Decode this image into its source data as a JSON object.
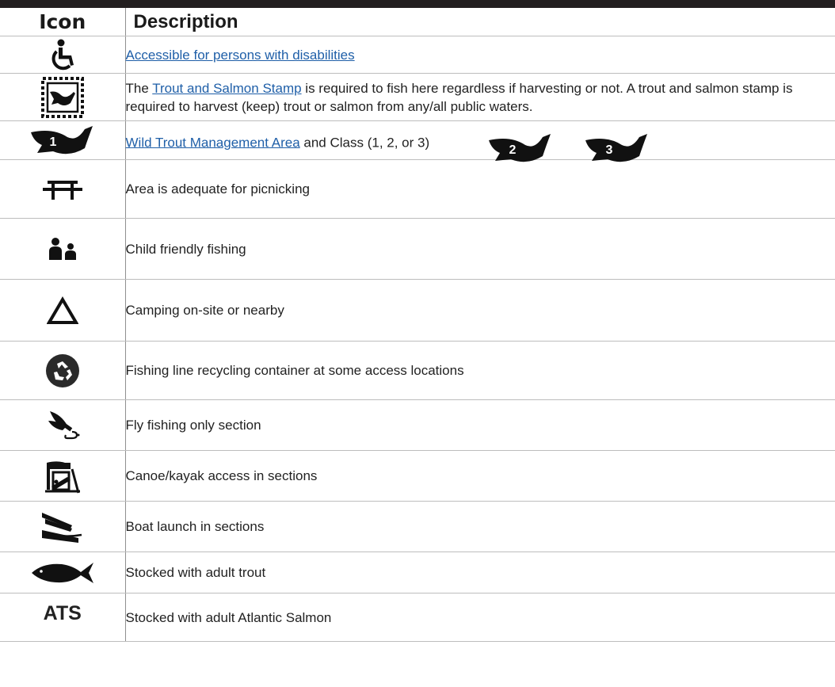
{
  "header": {
    "icon": "Icon",
    "description": "Description"
  },
  "rows": [
    {
      "icon": "wheelchair-icon",
      "link": "Accessible for persons with disabilities "
    },
    {
      "icon": "stamp-icon",
      "pre": "The ",
      "link": "Trout and Salmon Stamp",
      "post": " is required to fish here regardless if harvesting or not. A trout and salmon stamp is required to harvest (keep) trout or salmon from any/all public waters."
    },
    {
      "icon": "wild-trout-class-1-icon",
      "link": "Wild Trout Management Area",
      "post": " and Class (1, 2, or 3)",
      "badges": [
        "1",
        "2",
        "3"
      ]
    },
    {
      "icon": "picnic-table-icon",
      "text": "Area is adequate for picnicking"
    },
    {
      "icon": "child-friendly-icon",
      "text": "Child friendly fishing"
    },
    {
      "icon": "camping-tent-icon",
      "text": "Camping on-site or nearby"
    },
    {
      "icon": "recycle-icon",
      "text": "Fishing line recycling container at some access locations"
    },
    {
      "icon": "fly-fishing-icon",
      "text": "Fly fishing only section"
    },
    {
      "icon": "canoe-kayak-icon",
      "text": "Canoe/kayak access in sections"
    },
    {
      "icon": "boat-launch-icon",
      "text": "Boat launch in sections"
    },
    {
      "icon": "fish-icon",
      "text": "Stocked with adult trout"
    },
    {
      "icon": "ats-text-icon",
      "icon_text": "ATS",
      "text": "Stocked with adult Atlantic Salmon"
    }
  ]
}
